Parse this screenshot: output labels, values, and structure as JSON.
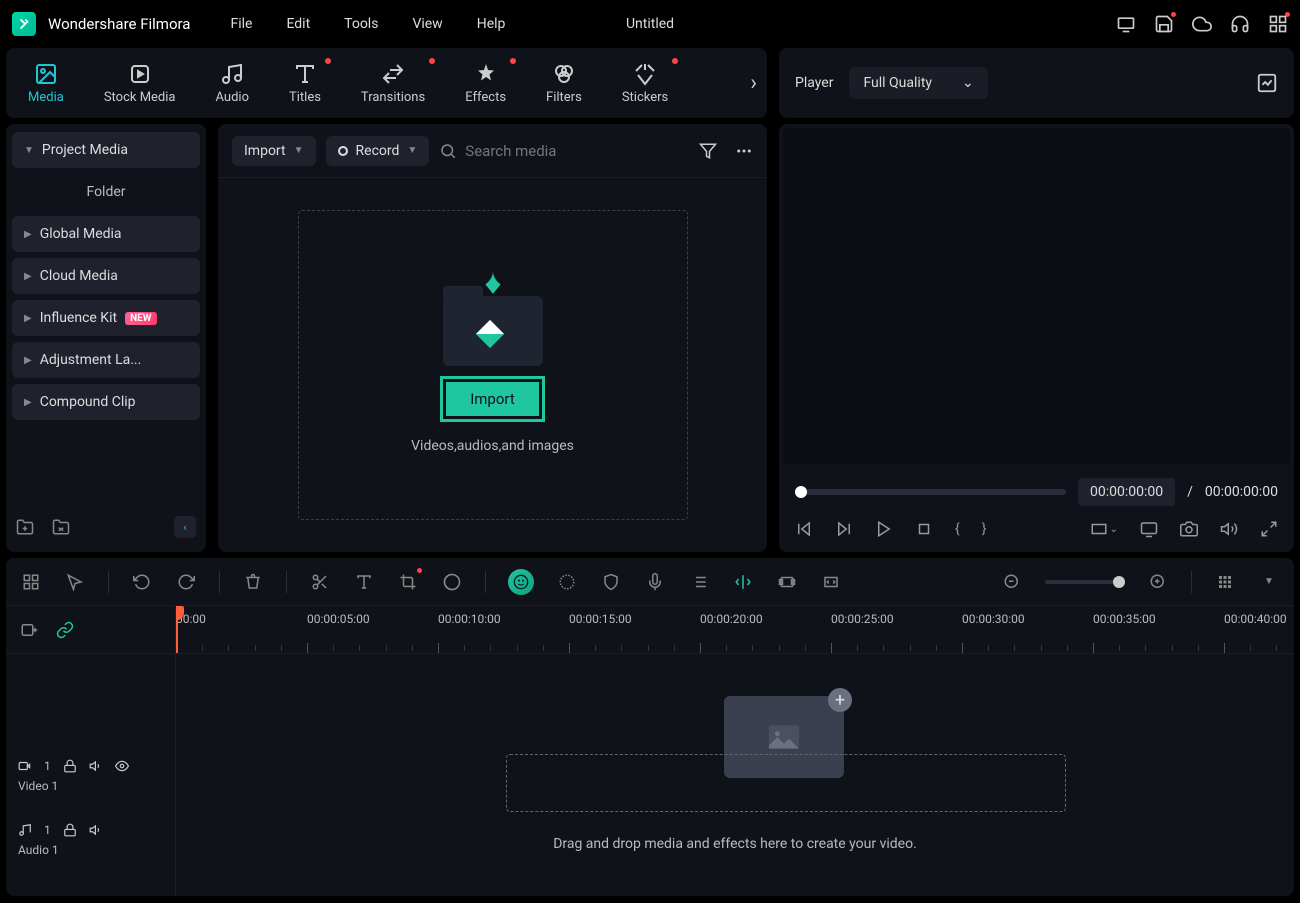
{
  "app": {
    "title": "Wondershare Filmora",
    "project": "Untitled"
  },
  "menu": {
    "file": "File",
    "edit": "Edit",
    "tools": "Tools",
    "view": "View",
    "help": "Help"
  },
  "ribbon": {
    "media": "Media",
    "stock_media": "Stock Media",
    "audio": "Audio",
    "titles": "Titles",
    "transitions": "Transitions",
    "effects": "Effects",
    "filters": "Filters",
    "stickers": "Stickers"
  },
  "player": {
    "label": "Player",
    "quality": "Full Quality",
    "current_time": "00:00:00:00",
    "total_time": "00:00:00:00",
    "separator": "/"
  },
  "sidebar": {
    "project_media": "Project Media",
    "folder": "Folder",
    "global_media": "Global Media",
    "cloud_media": "Cloud Media",
    "influence_kit": "Influence Kit",
    "influence_badge": "NEW",
    "adjustment_layer": "Adjustment La...",
    "compound_clip": "Compound Clip"
  },
  "center": {
    "import": "Import",
    "record": "Record",
    "search_placeholder": "Search media",
    "import_btn": "Import",
    "import_hint": "Videos,audios,and images"
  },
  "timeline": {
    "ticks": [
      "00:00",
      "00:00:05:00",
      "00:00:10:00",
      "00:00:15:00",
      "00:00:20:00",
      "00:00:25:00",
      "00:00:30:00",
      "00:00:35:00",
      "00:00:40:00"
    ],
    "video_track_num": "1",
    "video_track_label": "Video 1",
    "audio_track_num": "1",
    "audio_track_label": "Audio 1",
    "drop_hint": "Drag and drop media and effects here to create your video."
  }
}
